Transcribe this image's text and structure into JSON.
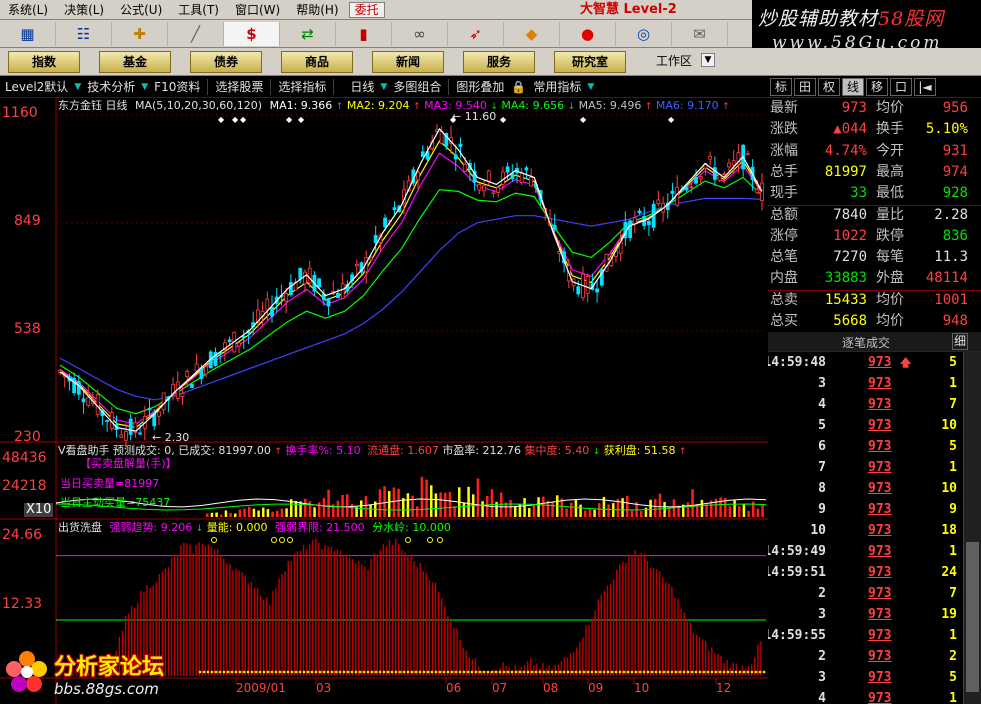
{
  "menu": {
    "items": [
      "系统(L)",
      "决策(L)",
      "公式(U)",
      "工具(T)",
      "窗口(W)",
      "帮助(H)"
    ],
    "order_button": "委托",
    "brand": "大智慧 Level-2"
  },
  "watermark_top": {
    "line1_a": "炒股辅助教材",
    "line1_b": "58股网",
    "line2": "www.58Gu.com"
  },
  "iconbar": {
    "icons": [
      "grid-icon",
      "table-icon",
      "crosshair-icon",
      "ruler-icon",
      "dollar-icon",
      "exchange-icon",
      "candle-icon",
      "binoculars-icon",
      "rocket-icon",
      "diamond-icon",
      "fire-icon",
      "globe-icon",
      "envelope-icon"
    ]
  },
  "modules": {
    "buttons": [
      "指数",
      "基金",
      "债券",
      "商品",
      "新闻",
      "服务",
      "研究室"
    ],
    "workarea": "工作区"
  },
  "subbar": {
    "items": [
      "Level2默认",
      "技术分析",
      "F10资料",
      "选择股票",
      "选择指标",
      "日线",
      "多图组合",
      "图形叠加",
      "常用指标"
    ]
  },
  "right_tabs": [
    "标",
    "田",
    "权",
    "线",
    "移",
    "口",
    "|◄"
  ],
  "chart_header": {
    "stock": "东方金钰",
    "period": "日线",
    "ma_params": "MA(5,10,20,30,60,120)",
    "ma1": "MA1: 9.366",
    "ma2": "MA2: 9.204",
    "ma3": "MA3: 9.540",
    "ma4": "MA4: 9.656",
    "ma5": "MA5: 9.496",
    "ma6": "MA6: 9.170"
  },
  "price_axis": [
    "1160",
    "849",
    "538",
    "230"
  ],
  "annotations": {
    "high": "11.60",
    "low": "2.30"
  },
  "vol_header": {
    "name": "V看盘助手",
    "pred": "预测成交: 0, 已成交: 81997.00",
    "turnover": "换手率%: 5.10",
    "float": "流通盘: 1.607",
    "pe": "市盈率: 212.76",
    "conc": "集中度: 5.40",
    "profit": "获利盘: 51.58"
  },
  "vol_labels": {
    "title": "【买卖盘解量(手)】",
    "buy": "当日买卖量=81997",
    "active": "当日主动买量=75437",
    "axis": [
      "48436",
      "24218",
      "X10"
    ]
  },
  "osc_header": {
    "name": "出货洗盘",
    "strong": "强弱趋势: 9.206",
    "energy": "量能: 0.000",
    "limit": "强弱界限: 21.500",
    "water": "分水岭: 10.000"
  },
  "osc_axis": [
    "24.66",
    "12.33"
  ],
  "date_axis": [
    "2009/01",
    "03",
    "06",
    "07",
    "08",
    "09",
    "10",
    "12"
  ],
  "quote": {
    "rows": [
      {
        "k1": "最新",
        "v1": "973",
        "c1": "red",
        "k2": "均价",
        "v2": "956",
        "c2": "red"
      },
      {
        "k1": "涨跌",
        "v1": "▲044",
        "c1": "red",
        "k2": "换手",
        "v2": "5.10%",
        "c2": "yel"
      },
      {
        "k1": "涨幅",
        "v1": "4.74%",
        "c1": "red",
        "k2": "今开",
        "v2": "931",
        "c2": "red"
      },
      {
        "k1": "总手",
        "v1": "81997",
        "c1": "yel",
        "k2": "最高",
        "v2": "974",
        "c2": "red"
      },
      {
        "k1": "现手",
        "v1": "33",
        "c1": "grn",
        "k2": "最低",
        "v2": "928",
        "c2": "grn"
      },
      {
        "k1": "总额",
        "v1": "7840",
        "c1": "wht",
        "k2": "量比",
        "v2": "2.28",
        "c2": "wht"
      },
      {
        "k1": "涨停",
        "v1": "1022",
        "c1": "red",
        "k2": "跌停",
        "v2": "836",
        "c2": "grn"
      },
      {
        "k1": "总笔",
        "v1": "7270",
        "c1": "wht",
        "k2": "每笔",
        "v2": "11.3",
        "c2": "wht"
      },
      {
        "k1": "内盘",
        "v1": "33883",
        "c1": "grn",
        "k2": "外盘",
        "v2": "48114",
        "c2": "red"
      },
      {
        "k1": "总卖",
        "v1": "15433",
        "c1": "yel",
        "k2": "均价",
        "v2": "1001",
        "c2": "red"
      },
      {
        "k1": "总买",
        "v1": "5668",
        "c1": "yel",
        "k2": "均价",
        "v2": "948",
        "c2": "red"
      }
    ]
  },
  "ticks": {
    "header": "逐笔成交",
    "detail": "细",
    "rows": [
      {
        "t": "14:59:48",
        "p": "973",
        "v": "5",
        "up": true
      },
      {
        "t": "3",
        "p": "973",
        "v": "1",
        "up": false
      },
      {
        "t": "4",
        "p": "973",
        "v": "7",
        "up": false
      },
      {
        "t": "5",
        "p": "973",
        "v": "10",
        "up": false
      },
      {
        "t": "6",
        "p": "973",
        "v": "5",
        "up": false
      },
      {
        "t": "7",
        "p": "973",
        "v": "1",
        "up": false
      },
      {
        "t": "8",
        "p": "973",
        "v": "10",
        "up": false
      },
      {
        "t": "9",
        "p": "973",
        "v": "9",
        "up": false
      },
      {
        "t": "10",
        "p": "973",
        "v": "18",
        "up": false
      },
      {
        "t": "14:59:49",
        "p": "973",
        "v": "1",
        "up": false
      },
      {
        "t": "14:59:51",
        "p": "973",
        "v": "24",
        "up": false
      },
      {
        "t": "2",
        "p": "973",
        "v": "7",
        "up": false
      },
      {
        "t": "3",
        "p": "973",
        "v": "19",
        "up": false
      },
      {
        "t": "14:59:55",
        "p": "973",
        "v": "1",
        "up": false
      },
      {
        "t": "2",
        "p": "973",
        "v": "2",
        "up": false
      },
      {
        "t": "3",
        "p": "973",
        "v": "5",
        "up": false
      },
      {
        "t": "4",
        "p": "973",
        "v": "1",
        "up": false
      }
    ]
  },
  "watermark_bottom": {
    "title": "分析家论坛",
    "url": "bbs.88gs.com"
  },
  "colors": {
    "up": "#ff4040",
    "down": "#00e0ff",
    "ma1": "#ffffff",
    "ma2": "#ffff00",
    "ma3": "#ff00ff",
    "ma4": "#00ff00",
    "ma5": "#a0a0a0",
    "ma6": "#4040ff"
  },
  "chart_data": {
    "type": "line",
    "title": "东方金钰 日线",
    "y_axis_ticks": [
      11.6,
      8.49,
      5.38,
      2.3
    ],
    "ylim": [
      2.3,
      11.6
    ],
    "x_labels": [
      "2009/01",
      "03",
      "06",
      "07",
      "08",
      "09",
      "10",
      "12"
    ],
    "series": [
      {
        "name": "MA1",
        "values": [
          4.2,
          3.8,
          3.2,
          2.6,
          2.5,
          3.0,
          3.6,
          4.1,
          4.6,
          5.0,
          5.4,
          6.0,
          6.6,
          7.0,
          6.4,
          6.6,
          7.2,
          8.2,
          9.0,
          10.2,
          11.2,
          10.6,
          9.8,
          9.6,
          10.0,
          9.8,
          8.2,
          6.8,
          6.6,
          7.4,
          8.4,
          8.6,
          9.0,
          9.6,
          10.2,
          9.8,
          10.4,
          9.4
        ]
      },
      {
        "name": "MA6",
        "values": [
          4.6,
          4.3,
          4.0,
          3.7,
          3.5,
          3.4,
          3.5,
          3.7,
          3.9,
          4.1,
          4.3,
          4.5,
          4.7,
          4.9,
          5.1,
          5.3,
          5.6,
          6.0,
          6.5,
          7.1,
          7.7,
          8.2,
          8.5,
          8.6,
          8.7,
          8.7,
          8.6,
          8.5,
          8.4,
          8.5,
          8.6,
          8.8,
          9.0,
          9.1,
          9.2,
          9.2,
          9.2,
          9.17
        ]
      }
    ],
    "volume": {
      "ylim": [
        0,
        48436
      ],
      "values": [
        900,
        1400,
        2000,
        2600,
        1800,
        3000,
        4200,
        3600,
        5200,
        4800,
        3800,
        6000,
        5400,
        4400,
        7000,
        6200,
        5000,
        5800,
        6600,
        4800,
        3600,
        4200,
        5200,
        3800,
        3000,
        2600,
        3400,
        4600,
        2800,
        3600,
        4000,
        3200,
        5000,
        4200,
        3600,
        2800,
        3000,
        4400
      ]
    },
    "oscillator": {
      "ylim": [
        0,
        24.66
      ],
      "levels": {
        "limit": 21.5,
        "water": 10.0
      },
      "values": [
        0.5,
        0.5,
        0.6,
        0.5,
        0.8,
        1.2,
        4.0,
        10.0,
        13.0,
        15.5,
        17.0,
        18.5,
        21.0,
        23.5,
        22.5,
        24.0,
        23.0,
        21.5,
        20.0,
        18.0,
        17.0,
        15.0,
        13.0,
        18.0,
        20.5,
        22.0,
        23.5,
        24.0,
        22.5,
        23.0,
        21.0,
        20.5,
        19.0,
        22.0,
        23.5,
        24.0,
        22.0,
        20.5,
        19.0,
        17.0,
        13.0,
        9.5,
        6.0,
        3.0,
        1.5,
        1.2,
        2.0,
        1.5,
        1.0,
        2.5,
        1.8,
        1.2,
        2.0,
        3.5,
        6.0,
        9.0,
        13.0,
        16.0,
        18.5,
        21.0,
        22.5,
        21.0,
        19.0,
        17.0,
        15.0,
        11.0,
        8.0,
        6.0,
        4.5,
        3.0,
        2.0,
        1.5,
        2.5,
        6.0
      ]
    }
  }
}
